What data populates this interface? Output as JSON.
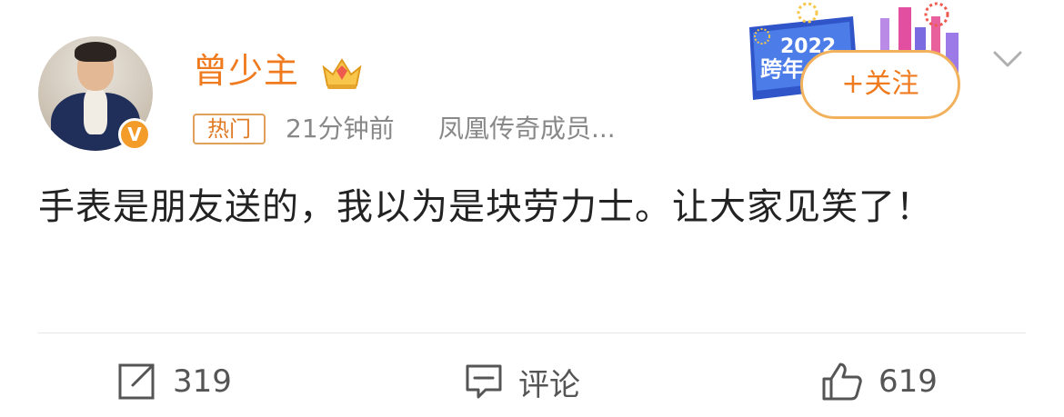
{
  "post": {
    "author_name": "曾少主",
    "hot_tag": "热门",
    "time": "21分钟前",
    "source": "凤凰传奇成员...",
    "text": "手表是朋友送的，我以为是块劳力士。让大家见笑了！",
    "follow_label": "+关注",
    "banner_year": "2022",
    "banner_text": "跨年"
  },
  "actions": {
    "repost_count": "319",
    "comment_label": "评论",
    "like_count": "619"
  },
  "colors": {
    "accent": "#f07a1e",
    "verified_badge": "#f39c2a",
    "follow_border": "#f2b25d",
    "meta_gray": "#888888",
    "divider": "#e6e6e6"
  },
  "icons": {
    "repost": "share-icon",
    "comment": "comment-icon",
    "like": "thumbs-up-icon",
    "crown": "crown-icon",
    "chevron": "chevron-down-icon",
    "verified": "verified-badge-icon"
  }
}
